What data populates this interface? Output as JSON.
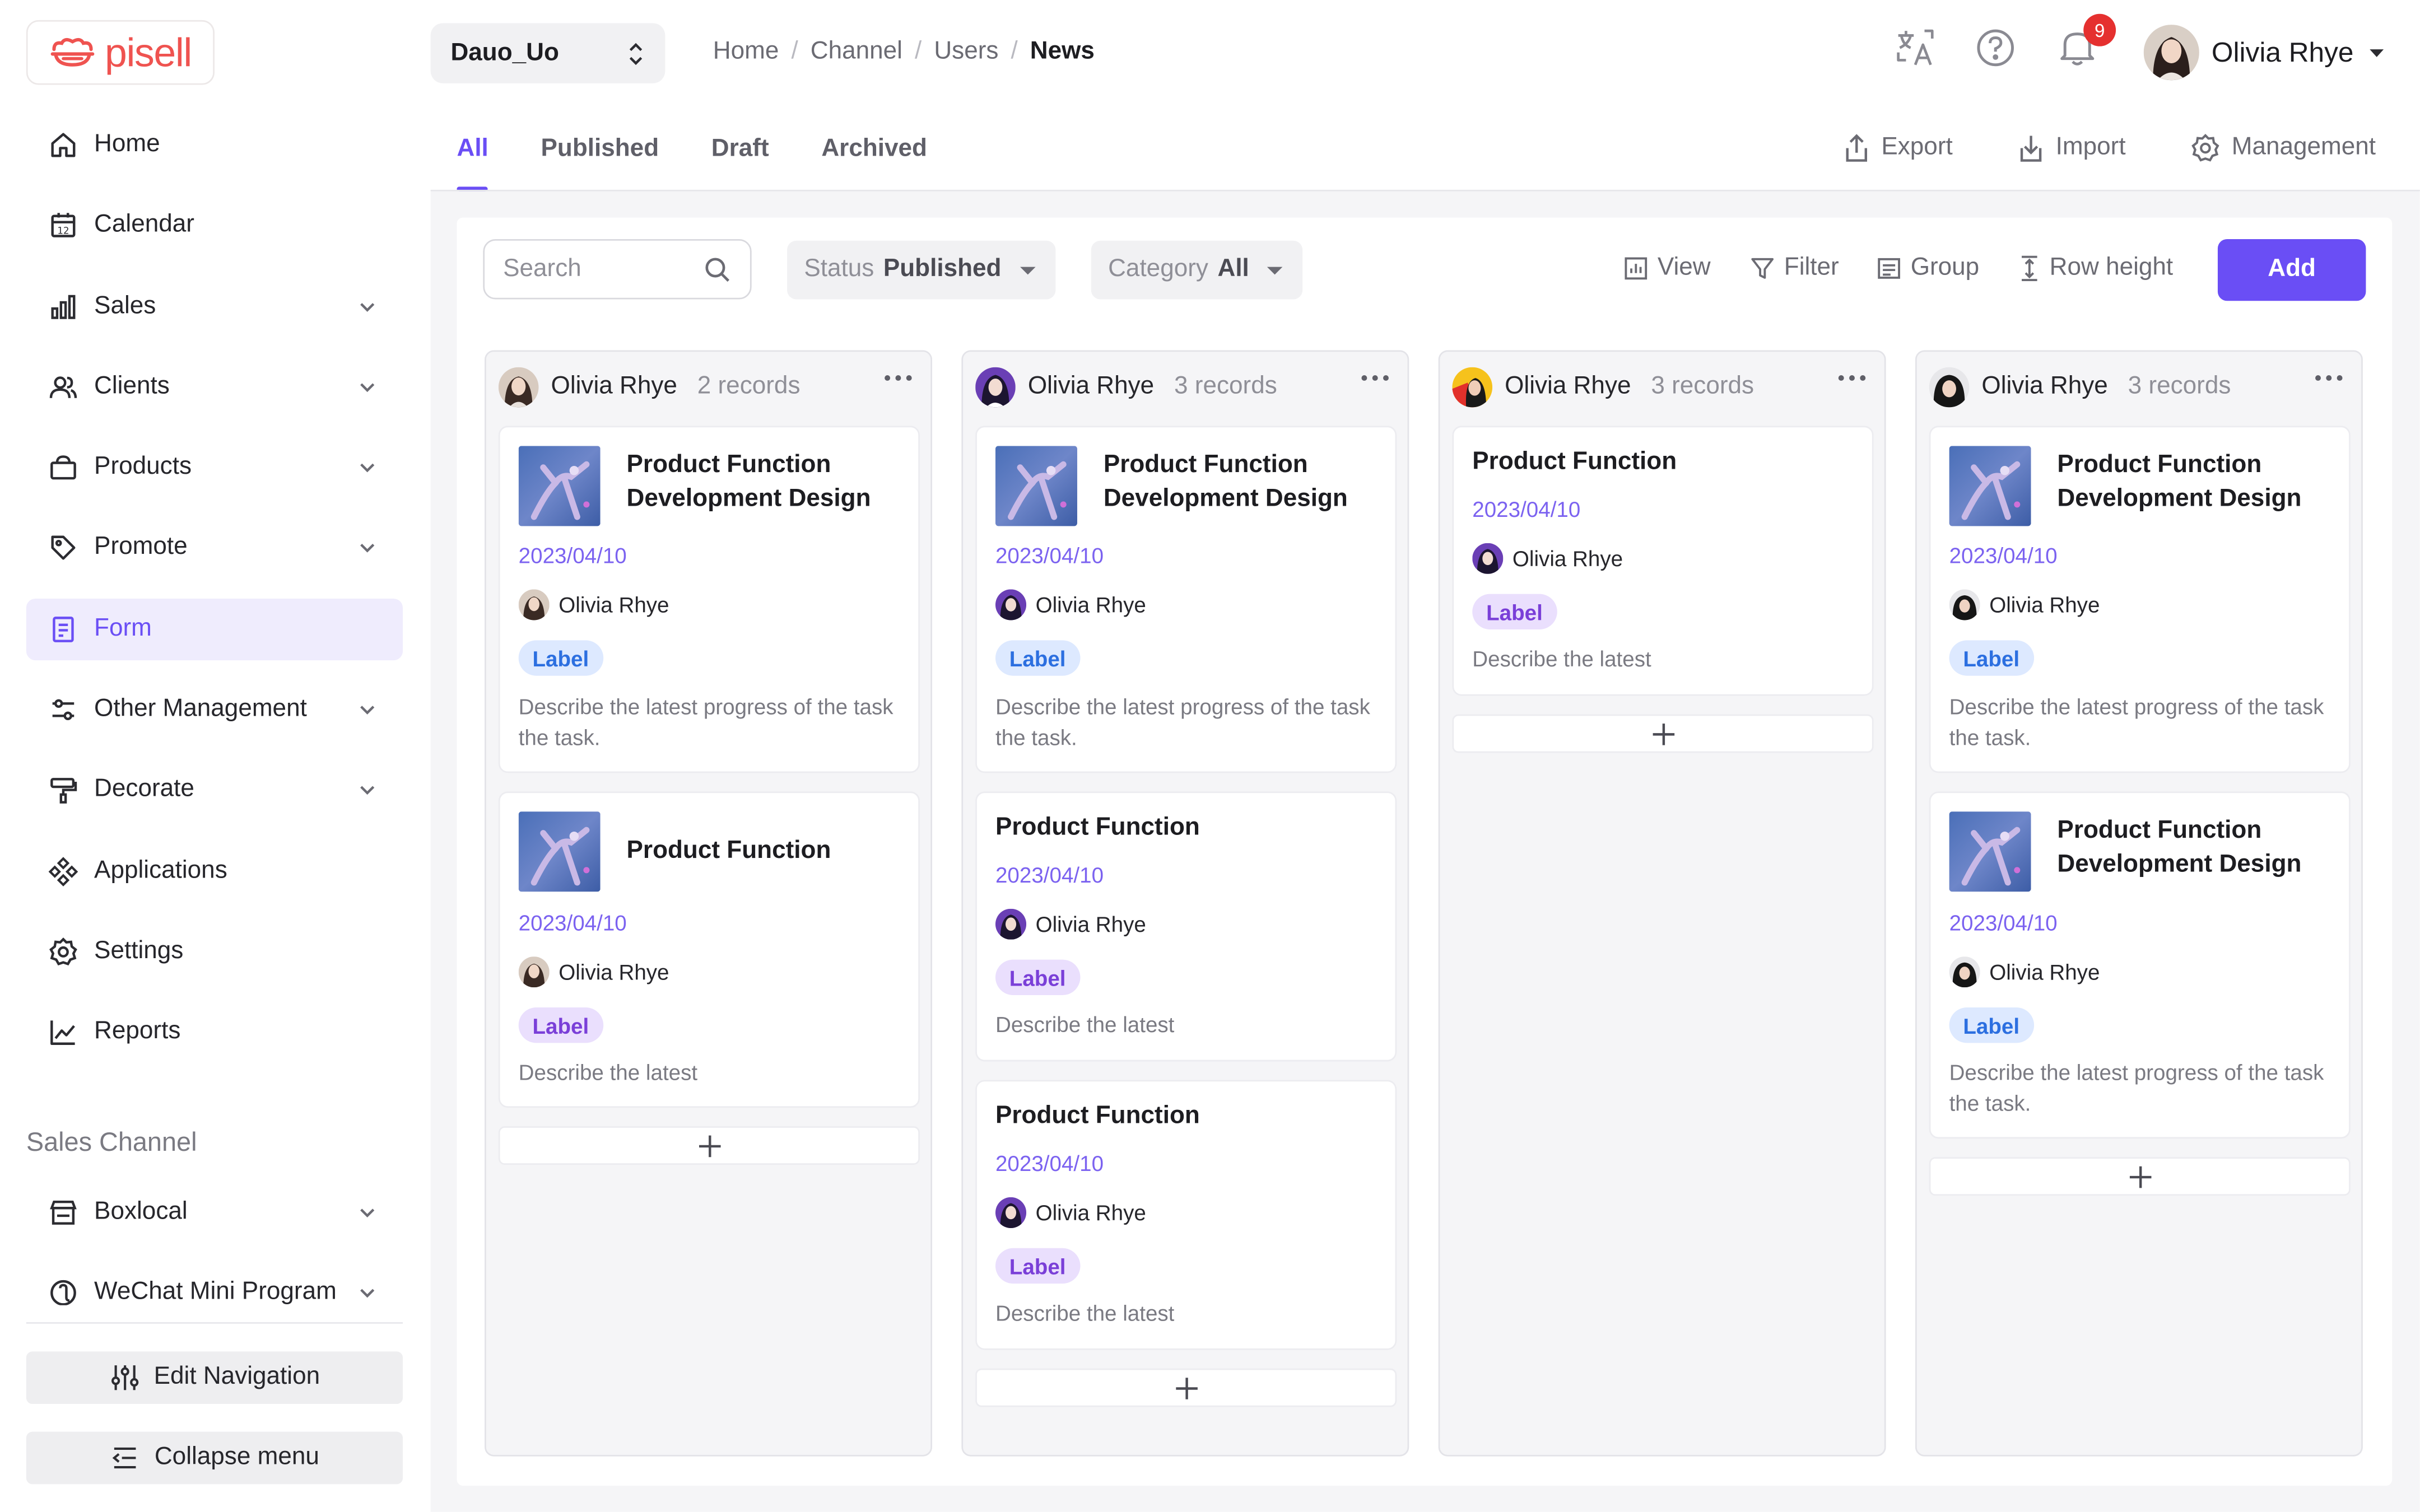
{
  "brand": {
    "name": "pisell"
  },
  "sidebar": {
    "items": [
      {
        "label": "Home",
        "icon": "home-icon",
        "expandable": false
      },
      {
        "label": "Calendar",
        "icon": "calendar-icon",
        "expandable": false
      },
      {
        "label": "Sales",
        "icon": "bar-chart-icon",
        "expandable": true
      },
      {
        "label": "Clients",
        "icon": "users-icon",
        "expandable": true
      },
      {
        "label": "Products",
        "icon": "bag-icon",
        "expandable": true
      },
      {
        "label": "Promote",
        "icon": "tag-icon",
        "expandable": true
      },
      {
        "label": "Form",
        "icon": "form-icon",
        "expandable": false,
        "active": true
      },
      {
        "label": "Other Management",
        "icon": "sliders-icon",
        "expandable": true
      },
      {
        "label": "Decorate",
        "icon": "paint-roller-icon",
        "expandable": true
      },
      {
        "label": "Applications",
        "icon": "apps-icon",
        "expandable": false
      },
      {
        "label": "Settings",
        "icon": "gear-icon",
        "expandable": false
      },
      {
        "label": "Reports",
        "icon": "line-chart-icon",
        "expandable": false
      }
    ],
    "section_title": "Sales Channel",
    "channel_items": [
      {
        "label": "Boxlocal",
        "icon": "store-icon"
      },
      {
        "label": "WeChat Mini Program",
        "icon": "mini-program-icon"
      }
    ],
    "edit_nav_label": "Edit Navigation",
    "collapse_label": "Collapse menu"
  },
  "topbar": {
    "store": "Dauo_Uo",
    "breadcrumb": [
      "Home",
      "Channel",
      "Users",
      "News"
    ],
    "notification_count": "9",
    "user_name": "Olivia Rhye"
  },
  "tabs": [
    "All",
    "Published",
    "Draft",
    "Archived"
  ],
  "actions": {
    "export": "Export",
    "import": "Import",
    "management": "Management"
  },
  "toolbar": {
    "search_placeholder": "Search",
    "status_label": "Status",
    "status_value": "Published",
    "category_label": "Category",
    "category_value": "All",
    "view": "View",
    "filter": "Filter",
    "group": "Group",
    "row_height": "Row height",
    "add": "Add"
  },
  "columns": [
    {
      "owner": "Olivia Rhye",
      "count": "2 records",
      "cards": [
        {
          "title": "Product Function Development Design",
          "date": "2023/04/10",
          "user": "Olivia Rhye",
          "label": "Label",
          "label_color": "blue",
          "desc": "Describe the latest progress of the task the task.",
          "has_image": true
        },
        {
          "title": "Product Function",
          "date": "2023/04/10",
          "user": "Olivia Rhye",
          "label": "Label",
          "label_color": "purple",
          "desc": "Describe the latest",
          "has_image": true
        }
      ]
    },
    {
      "owner": "Olivia Rhye",
      "count": "3 records",
      "cards": [
        {
          "title": "Product Function Development Design",
          "date": "2023/04/10",
          "user": "Olivia Rhye",
          "label": "Label",
          "label_color": "blue",
          "desc": "Describe the latest progress of the task the task.",
          "has_image": true
        },
        {
          "title": "Product Function",
          "date": "2023/04/10",
          "user": "Olivia Rhye",
          "label": "Label",
          "label_color": "purple",
          "desc": "Describe the latest",
          "has_image": false
        },
        {
          "title": "Product Function",
          "date": "2023/04/10",
          "user": "Olivia Rhye",
          "label": "Label",
          "label_color": "purple",
          "desc": "Describe the latest",
          "has_image": false
        }
      ]
    },
    {
      "owner": "Olivia Rhye",
      "count": "3 records",
      "cards": [
        {
          "title": "Product Function",
          "date": "2023/04/10",
          "user": "Olivia Rhye",
          "label": "Label",
          "label_color": "purple",
          "desc": "Describe the latest",
          "has_image": false
        }
      ]
    },
    {
      "owner": "Olivia Rhye",
      "count": "3 records",
      "cards": [
        {
          "title": "Product Function Development Design",
          "date": "2023/04/10",
          "user": "Olivia Rhye",
          "label": "Label",
          "label_color": "blue",
          "desc": "Describe the latest progress of the task the task.",
          "has_image": true
        },
        {
          "title": "Product Function Development Design",
          "date": "2023/04/10",
          "user": "Olivia Rhye",
          "label": "Label",
          "label_color": "blue",
          "desc": "Describe the latest progress of the task the task.",
          "has_image": true
        }
      ]
    }
  ],
  "colors": {
    "accent": "#6a4ef5",
    "badge": "#e5302f",
    "brand": "#ef5350"
  }
}
